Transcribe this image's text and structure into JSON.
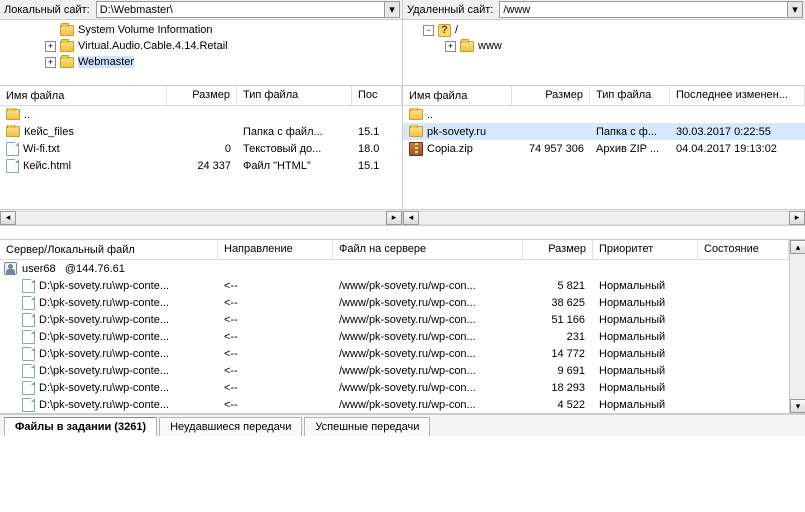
{
  "local": {
    "label": "Локальный сайт:",
    "path": "D:\\Webmaster\\",
    "tree": [
      {
        "name": "System Volume Information",
        "expander": ""
      },
      {
        "name": "Virtual.Audio.Cable.4.14.Retail",
        "expander": "+"
      },
      {
        "name": "Webmaster",
        "expander": "+",
        "selected": true
      }
    ],
    "cols": {
      "name": "Имя файла",
      "size": "Размер",
      "type": "Тип файла",
      "date": "Пос"
    },
    "rows": [
      {
        "icon": "folder",
        "name": "..",
        "size": "",
        "type": "",
        "date": ""
      },
      {
        "icon": "folder",
        "name": "Кейс_files",
        "size": "",
        "type": "Папка с файл...",
        "date": "15.1"
      },
      {
        "icon": "file",
        "name": "Wi-fi.txt",
        "size": "0",
        "type": "Текстовый до...",
        "date": "18.0"
      },
      {
        "icon": "file",
        "name": "Кейс.html",
        "size": "24 337",
        "type": "Файл \"HTML\"",
        "date": "15.1"
      }
    ]
  },
  "remote": {
    "label": "Удаленный сайт:",
    "path": "/www",
    "tree": [
      {
        "name": "/",
        "expander": "-",
        "icon": "q"
      },
      {
        "name": "www",
        "expander": "+",
        "icon": "folder",
        "indent": 1
      }
    ],
    "cols": {
      "name": "Имя файла",
      "size": "Размер",
      "type": "Тип файла",
      "date": "Последнее изменен..."
    },
    "rows": [
      {
        "icon": "folder",
        "name": "..",
        "size": "",
        "type": "",
        "date": ""
      },
      {
        "icon": "folder",
        "name": "pk-sovety.ru",
        "size": "",
        "type": "Папка с ф...",
        "date": "30.03.2017 0:22:55",
        "selected": true
      },
      {
        "icon": "zip",
        "name": "Copia.zip",
        "size": "74 957 306",
        "type": "Архив ZIP ...",
        "date": "04.04.2017 19:13:02"
      }
    ]
  },
  "queue": {
    "cols": {
      "local": "Сервер/Локальный файл",
      "dir": "Направление",
      "remote": "Файл на сервере",
      "size": "Размер",
      "pri": "Приоритет",
      "state": "Состояние"
    },
    "host": {
      "user": "user68",
      "at": "@144.76.61"
    },
    "rows": [
      {
        "local": "D:\\pk-sovety.ru\\wp-conte...",
        "dir": "<--",
        "remote": "/www/pk-sovety.ru/wp-con...",
        "size": "5 821",
        "pri": "Нормальный"
      },
      {
        "local": "D:\\pk-sovety.ru\\wp-conte...",
        "dir": "<--",
        "remote": "/www/pk-sovety.ru/wp-con...",
        "size": "38 625",
        "pri": "Нормальный"
      },
      {
        "local": "D:\\pk-sovety.ru\\wp-conte...",
        "dir": "<--",
        "remote": "/www/pk-sovety.ru/wp-con...",
        "size": "51 166",
        "pri": "Нормальный"
      },
      {
        "local": "D:\\pk-sovety.ru\\wp-conte...",
        "dir": "<--",
        "remote": "/www/pk-sovety.ru/wp-con...",
        "size": "231",
        "pri": "Нормальный"
      },
      {
        "local": "D:\\pk-sovety.ru\\wp-conte...",
        "dir": "<--",
        "remote": "/www/pk-sovety.ru/wp-con...",
        "size": "14 772",
        "pri": "Нормальный"
      },
      {
        "local": "D:\\pk-sovety.ru\\wp-conte...",
        "dir": "<--",
        "remote": "/www/pk-sovety.ru/wp-con...",
        "size": "9 691",
        "pri": "Нормальный"
      },
      {
        "local": "D:\\pk-sovety.ru\\wp-conte...",
        "dir": "<--",
        "remote": "/www/pk-sovety.ru/wp-con...",
        "size": "18 293",
        "pri": "Нормальный"
      },
      {
        "local": "D:\\pk-sovety.ru\\wp-conte...",
        "dir": "<--",
        "remote": "/www/pk-sovety.ru/wp-con...",
        "size": "4 522",
        "pri": "Нормальный"
      }
    ]
  },
  "tabs": {
    "queued": {
      "label": "Файлы в задании",
      "count": "(3261)"
    },
    "failed": "Неудавшиеся передачи",
    "success": "Успешные передачи"
  }
}
